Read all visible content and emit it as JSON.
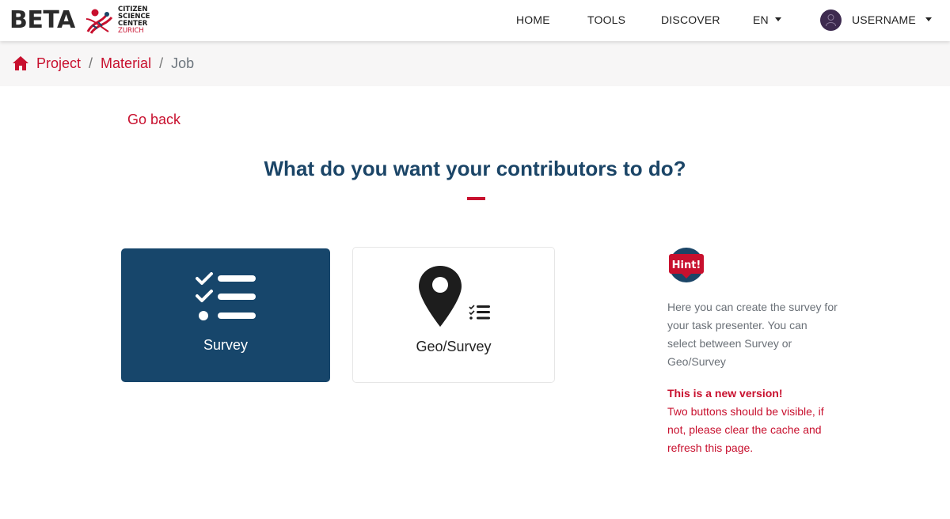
{
  "navbar": {
    "beta_label": "BETA",
    "logo_lines": [
      "CITIZEN",
      "SCIENCE",
      "CENTER",
      "ZURICH"
    ],
    "items": [
      "HOME",
      "TOOLS",
      "DISCOVER"
    ],
    "language": "EN",
    "username": "USERNAME"
  },
  "breadcrumb": {
    "items": [
      "Project",
      "Material"
    ],
    "current": "Job"
  },
  "main": {
    "go_back": "Go back",
    "title": "What do you want your contributors to do?",
    "options": [
      {
        "label": "Survey",
        "icon": "checklist-icon",
        "selected": true
      },
      {
        "label": "Geo/Survey",
        "icon": "map-pin-checklist-icon",
        "selected": false
      }
    ]
  },
  "hint": {
    "badge": "Hint!",
    "text": "Here you can create the survey for your task presenter. You can select between Survey or Geo/Survey",
    "warning_title": "This is a new version!",
    "warning_body": "Two buttons should be visible, if not, please clear the cache and refresh this page."
  },
  "colors": {
    "accent": "#c8102e",
    "primary": "#17466b",
    "title": "#1b4567"
  }
}
